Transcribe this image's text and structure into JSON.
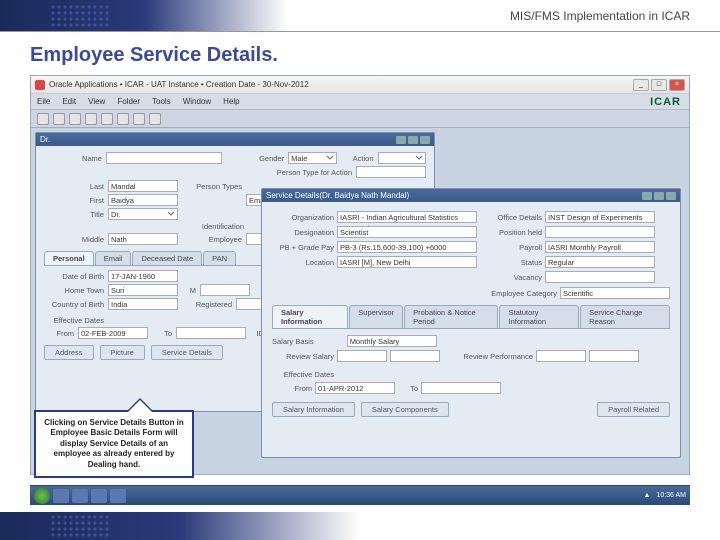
{
  "header": {
    "title": "MIS/FMS Implementation in ICAR"
  },
  "slide_title": "Employee Service Details.",
  "window": {
    "title": "Oracle Applications • ICAR - UAT Instance • Creation Date - 30-Nov-2012",
    "brand": "ICAR"
  },
  "menu": {
    "file": "Eile",
    "edit": "Edit",
    "view": "View",
    "folder": "Folder",
    "tools": "Tools",
    "window": "Window",
    "help": "Help"
  },
  "basic": {
    "title": "Dr.",
    "name_lbl": "Name",
    "gender_lbl": "Gender",
    "gender": "Male",
    "action_lbl": "Action",
    "ptype_action_lbl": "Person Type for Action",
    "last_lbl": "Last",
    "last": "Mandal",
    "first_lbl": "First",
    "first": "Baidya",
    "title_lbl": "Title",
    "ptypes_lbl": "Person Types",
    "ptypes": "Employee",
    "ident_lbl": "Identification",
    "emp_lbl": "Employee",
    "middle_lbl": "Middle",
    "middle": "Nath",
    "tabs": {
      "personal": "Personal",
      "email": "Email",
      "deceased": "Deceased Date",
      "pan": "PAN"
    },
    "dob_lbl": "Date of Birth",
    "dob": "17-JAN-1960",
    "home_lbl": "Home Town",
    "home": "Suri",
    "cob_lbl": "Country of Birth",
    "cob": "India",
    "marital_lbl": "M",
    "reg_lbl": "Registered",
    "eff_lbl": "Effective Dates",
    "from_lbl": "From",
    "from": "02-FEB-2009",
    "to_lbl": "To",
    "id_lbl": "ID",
    "btns": {
      "address": "Address",
      "picture": "Picture",
      "service": "Service Details"
    }
  },
  "service": {
    "title": "Service Details(Dr. Baidya Nath Mandal)",
    "org_lbl": "Organization",
    "org": "IASRI - Indian Agricultural Statistics Research",
    "office_lbl": "Office Details",
    "office": "INST Design of Experiments",
    "desig_lbl": "Designation",
    "desig": "Scientist",
    "pos_lbl": "Position held",
    "pb_lbl": "PB + Grade Pay",
    "pb": "PB-3 (Rs.15,600-39,100) +6000",
    "payroll_lbl": "Payroll",
    "payroll": "IASRI Monthly Payroll",
    "loc_lbl": "Location",
    "loc": "IASRI [M], New Delhi",
    "status_lbl": "Status",
    "status": "Regular",
    "vac_lbl": "Vacancy",
    "empcat_lbl": "Employee Category",
    "empcat": "Scientific",
    "tabs": {
      "salary": "Salary Information",
      "supervisor": "Supervisor",
      "probation": "Probation & Notice Period",
      "statutory": "Statutory Information",
      "change": "Service Change Reason"
    },
    "basis_lbl": "Salary Basis",
    "basis": "Monthly Salary",
    "review_lbl": "Review Salary",
    "perf_lbl": "Review Performance",
    "eff_lbl": "Effective Dates",
    "from_lbl": "From",
    "from": "01-APR-2012",
    "to_lbl": "To",
    "btns": {
      "si": "Salary Information",
      "sc": "Salary Components",
      "pr": "Payroll Related"
    }
  },
  "callout": "Clicking on Service Details Button in Employee Basic Details Form will display Service Details of an employee as already entered by Dealing hand.",
  "taskbar": {
    "time": "10:36 AM"
  }
}
